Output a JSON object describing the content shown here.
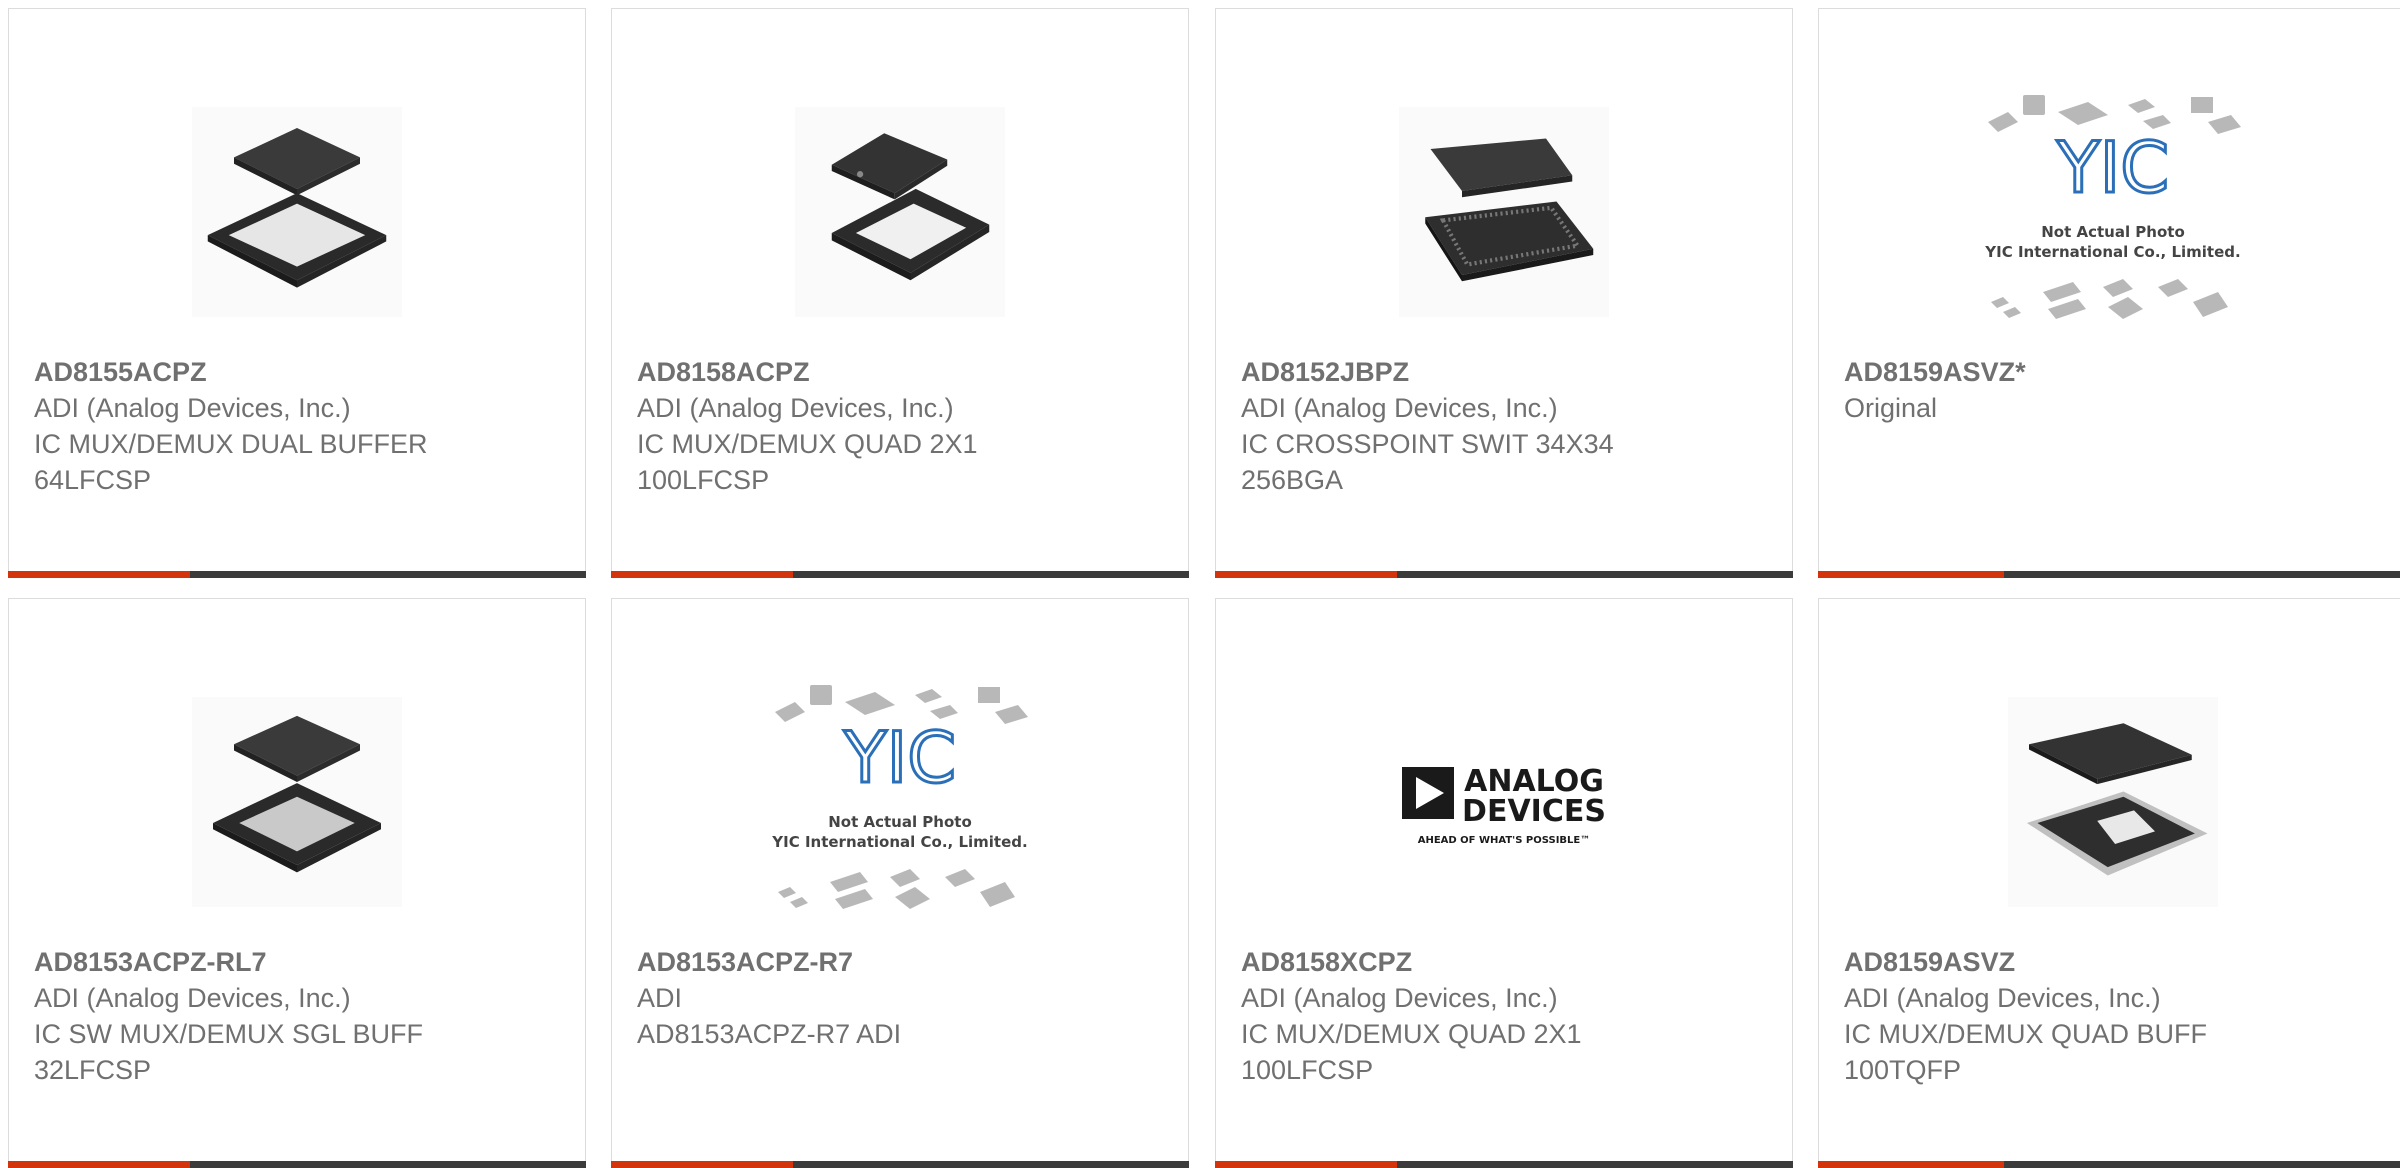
{
  "colors": {
    "accent": "#d4340c",
    "bar": "#3b3b3b",
    "border": "#dcdcdc",
    "text": "#707070"
  },
  "products": [
    {
      "part": "AD8155ACPZ",
      "lines": [
        "ADI (Analog Devices, Inc.)",
        "IC MUX/DEMUX DUAL BUFFER",
        "64LFCSP"
      ],
      "image": "qfn-64-icon"
    },
    {
      "part": "AD8158ACPZ",
      "lines": [
        "ADI (Analog Devices, Inc.)",
        "IC MUX/DEMUX QUAD 2X1",
        "100LFCSP"
      ],
      "image": "qfn-100-icon"
    },
    {
      "part": "AD8152JBPZ",
      "lines": [
        "ADI (Analog Devices, Inc.)",
        "IC CROSSPOINT SWIT 34X34",
        "256BGA"
      ],
      "image": "bga-256-icon"
    },
    {
      "part": "AD8159ASVZ*",
      "lines": [
        "Original"
      ],
      "image": "placeholder-photo",
      "placeholder": {
        "logo": "YIC",
        "line1": "Not Actual Photo",
        "line2": "YIC International Co., Limited."
      }
    },
    {
      "part": "AD8153ACPZ-RL7",
      "lines": [
        "ADI (Analog Devices, Inc.)",
        "IC SW MUX/DEMUX SGL BUFF",
        "32LFCSP"
      ],
      "image": "qfn-32-icon"
    },
    {
      "part": "AD8153ACPZ-R7",
      "lines": [
        "ADI",
        "AD8153ACPZ-R7 ADI"
      ],
      "image": "placeholder-photo",
      "placeholder": {
        "logo": "YIC",
        "line1": "Not Actual Photo",
        "line2": "YIC International Co., Limited."
      }
    },
    {
      "part": "AD8158XCPZ",
      "lines": [
        "ADI (Analog Devices, Inc.)",
        "IC MUX/DEMUX QUAD 2X1",
        "100LFCSP"
      ],
      "image": "analog-devices-logo",
      "logo": {
        "line1": "ANALOG",
        "line2": "DEVICES",
        "tagline": "AHEAD OF WHAT'S POSSIBLE™"
      }
    },
    {
      "part": "AD8159ASVZ",
      "lines": [
        "ADI (Analog Devices, Inc.)",
        "IC MUX/DEMUX QUAD BUFF",
        "100TQFP"
      ],
      "image": "tqfp-100-icon"
    }
  ]
}
